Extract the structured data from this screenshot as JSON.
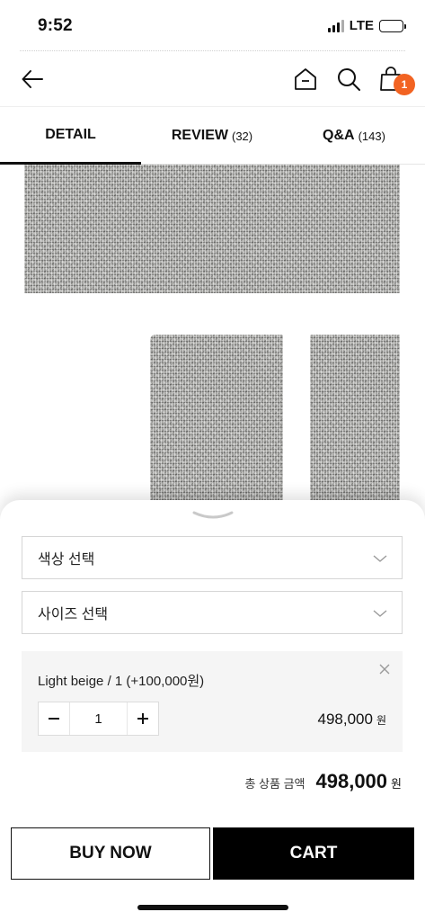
{
  "status_bar": {
    "time": "9:52",
    "network": "LTE"
  },
  "nav": {
    "back_icon": "arrow-left-icon",
    "home_icon": "home-icon",
    "search_icon": "search-icon",
    "bag_icon": "shopping-bag-icon",
    "cart_count": "1"
  },
  "tabs": [
    {
      "label": "DETAIL",
      "count": ""
    },
    {
      "label": "REVIEW",
      "count": "(32)"
    },
    {
      "label": "Q&A",
      "count": "(143)"
    }
  ],
  "options": {
    "color_placeholder": "색상 선택",
    "size_placeholder": "사이즈 선택"
  },
  "selected_item": {
    "title": "Light beige / 1 (+100,000원)",
    "quantity": "1",
    "price": "498,000",
    "currency": "원"
  },
  "total": {
    "label": "총 상품 금액",
    "amount": "498,000",
    "currency": "원"
  },
  "buttons": {
    "buy_now": "BUY NOW",
    "cart": "CART"
  },
  "colors": {
    "badge": "#f26322",
    "cart_button": "#000000",
    "option_bg": "#f5f5f5"
  }
}
